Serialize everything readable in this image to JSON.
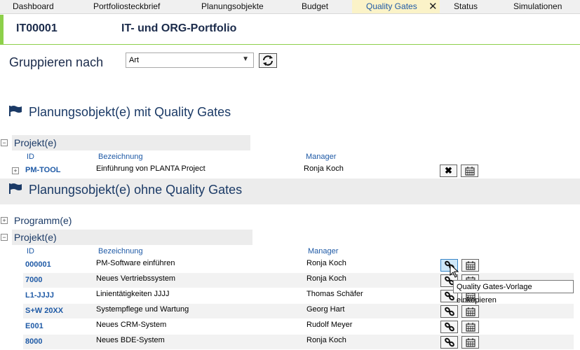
{
  "tabs": [
    {
      "label": "Dashboard"
    },
    {
      "label": "Portfoliosteckbrief"
    },
    {
      "label": "Planungsobjekte"
    },
    {
      "label": "Budget"
    },
    {
      "label": "Quality Gates",
      "active": true
    },
    {
      "label": "Status"
    },
    {
      "label": "Simulationen"
    }
  ],
  "tab_close_glyph": "✕",
  "header": {
    "id": "IT00001",
    "title": "IT- und ORG-Portfolio"
  },
  "grouping": {
    "label": "Gruppieren nach",
    "selected": "Art"
  },
  "section_with": {
    "title": "Planungsobjekt(e) mit Quality Gates",
    "group": "Projekt(e)",
    "columns": {
      "id": "ID",
      "name": "Bezeichnung",
      "manager": "Manager"
    },
    "rows": [
      {
        "id": "PM-TOOL",
        "name": "Einführung von PLANTA Project",
        "manager": "Ronja Koch"
      }
    ]
  },
  "section_without": {
    "title": "Planungsobjekt(e) ohne Quality Gates",
    "group_program": "Programm(e)",
    "group_project": "Projekt(e)",
    "columns": {
      "id": "ID",
      "name": "Bezeichnung",
      "manager": "Manager"
    },
    "rows": [
      {
        "id": "000001",
        "name": "PM-Software einführen",
        "manager": "Ronja Koch"
      },
      {
        "id": "7000",
        "name": "Neues Vertriebssystem",
        "manager": "Ronja Koch"
      },
      {
        "id": "L1-JJJJ",
        "name": "Linientätigkeiten JJJJ",
        "manager": "Thomas Schäfer"
      },
      {
        "id": "S+W 20XX",
        "name": "Systempflege und Wartung",
        "manager": "Georg Hart"
      },
      {
        "id": "E001",
        "name": "Neues CRM-System",
        "manager": "Rudolf Meyer"
      },
      {
        "id": "8000",
        "name": "Neues BDE-System",
        "manager": "Ronja Koch"
      }
    ]
  },
  "tooltip": "Quality Gates-Vorlage einkopieren",
  "colors": {
    "accent_green": "#8dd04a",
    "link_blue": "#1f5aa6",
    "title_navy": "#1b3a66",
    "active_tab_bg": "#fbf3c8"
  },
  "icons": [
    "flag-icon",
    "refresh-icon",
    "delete-icon",
    "calendar-icon",
    "link-icon",
    "dropdown-arrow-icon",
    "expand-icon",
    "collapse-icon",
    "mouse-cursor-icon"
  ]
}
